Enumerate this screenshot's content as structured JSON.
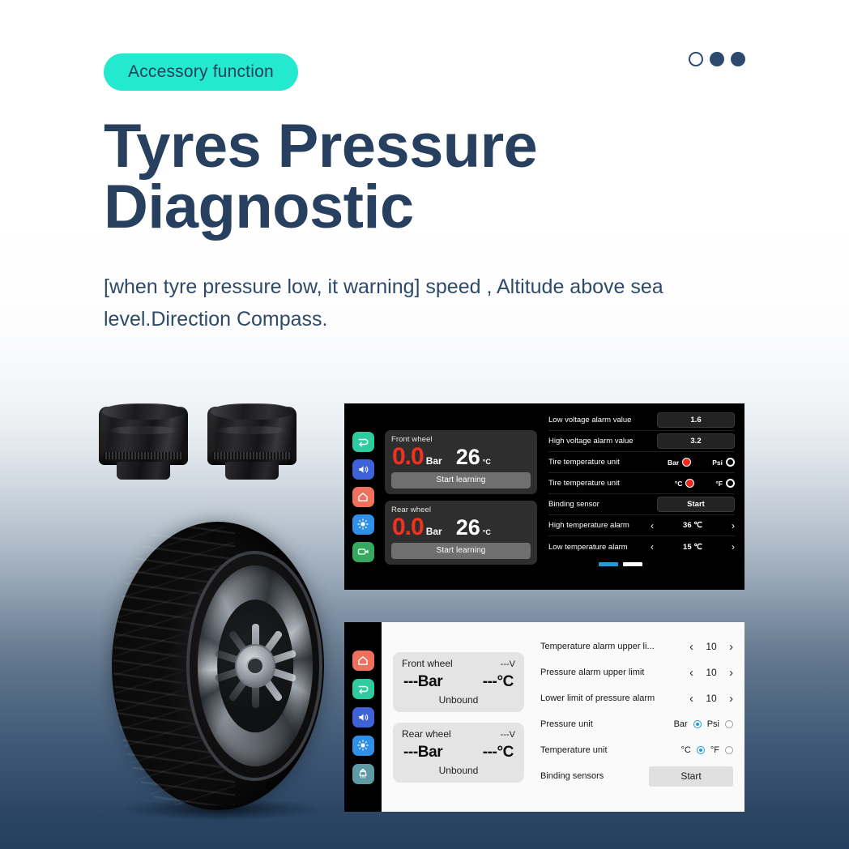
{
  "header": {
    "badge": "Accessory function",
    "title": "Tyres Pressure Diagnostic",
    "subtitle": "[when tyre pressure low, it warning] speed , Altitude above sea level.Direction Compass.",
    "pagination": [
      {
        "name": "dot-1",
        "state": "hollow"
      },
      {
        "name": "dot-2",
        "state": "solid"
      },
      {
        "name": "dot-3",
        "state": "solid"
      }
    ]
  },
  "colors": {
    "badge_bg": "#23e9cf",
    "title": "#28405f",
    "navy": "#2b4a6e",
    "alert_red": "#f0321e",
    "accent_blue": "#1f9bdc"
  },
  "dark_screen": {
    "rail_icons": [
      {
        "name": "back-arrow-icon",
        "color": "#2ecba0"
      },
      {
        "name": "speaker-icon",
        "color": "#3e63d8"
      },
      {
        "name": "home-icon",
        "color": "#f0705e"
      },
      {
        "name": "brightness-icon",
        "color": "#2f90e8"
      },
      {
        "name": "camcorder-icon",
        "color": "#35a95f"
      }
    ],
    "wheels": [
      {
        "label": "Front wheel",
        "pressure": "0.0",
        "pressure_unit": "Bar",
        "temperature": "26",
        "temperature_unit": "°C",
        "button": "Start learning"
      },
      {
        "label": "Rear wheel",
        "pressure": "0.0",
        "pressure_unit": "Bar",
        "temperature": "26",
        "temperature_unit": "°C",
        "button": "Start learning"
      }
    ],
    "settings": [
      {
        "type": "value",
        "label": "Low voltage alarm value",
        "value": "1.6"
      },
      {
        "type": "value",
        "label": "High voltage alarm value",
        "value": "3.2"
      },
      {
        "type": "radio",
        "label": "Tire temperature unit",
        "opt1": "Bar",
        "opt2": "Psi",
        "selected": 1
      },
      {
        "type": "radio",
        "label": "Tire temperature unit",
        "opt1": "°C",
        "opt2": "°F",
        "selected": 1
      },
      {
        "type": "button",
        "label": "Binding sensor",
        "value": "Start"
      },
      {
        "type": "stepper",
        "label": "High temperature alarm",
        "value": "36 ℃",
        "prev": "‹",
        "next": "›"
      },
      {
        "type": "stepper",
        "label": "Low temperature alarm",
        "value": "15 ℃",
        "prev": "‹",
        "next": "›"
      }
    ],
    "pager": [
      {
        "name": "page-indicator-1",
        "state": "on"
      },
      {
        "name": "page-indicator-2",
        "state": "off"
      }
    ]
  },
  "light_screen": {
    "rail_icons": [
      {
        "name": "home-icon",
        "color": "#f0705e"
      },
      {
        "name": "back-arrow-icon",
        "color": "#2ecba0"
      },
      {
        "name": "speaker-icon",
        "color": "#3e63d8"
      },
      {
        "name": "brightness-icon",
        "color": "#2f90e8"
      },
      {
        "name": "broom-icon",
        "color": "#5e9aa4"
      }
    ],
    "wheels": [
      {
        "label": "Front wheel",
        "voltage": "---V",
        "pressure": "---Bar",
        "temperature": "---°C",
        "status": "Unbound"
      },
      {
        "label": "Rear wheel",
        "voltage": "---V",
        "pressure": "---Bar",
        "temperature": "---°C",
        "status": "Unbound"
      }
    ],
    "settings": [
      {
        "type": "stepper",
        "label": "Temperature alarm upper li...",
        "value": "10",
        "prev": "‹",
        "next": "›"
      },
      {
        "type": "stepper",
        "label": "Pressure alarm upper limit",
        "value": "10",
        "prev": "‹",
        "next": "›"
      },
      {
        "type": "stepper",
        "label": "Lower limit of pressure alarm",
        "value": "10",
        "prev": "‹",
        "next": "›"
      },
      {
        "type": "radio",
        "label": "Pressure unit",
        "opt1": "Bar",
        "opt2": "Psi",
        "selected": 1
      },
      {
        "type": "radio",
        "label": "Temperature unit",
        "opt1": "°C",
        "opt2": "°F",
        "selected": 1
      },
      {
        "type": "button",
        "label": "Binding sensors",
        "value": "Start"
      }
    ]
  },
  "product_images": {
    "sensor_caps_count": 2,
    "sensor_caps_alt": "tpms-sensor-caps",
    "tyre_alt": "motorcycle-tyre-with-alloy-wheel"
  }
}
